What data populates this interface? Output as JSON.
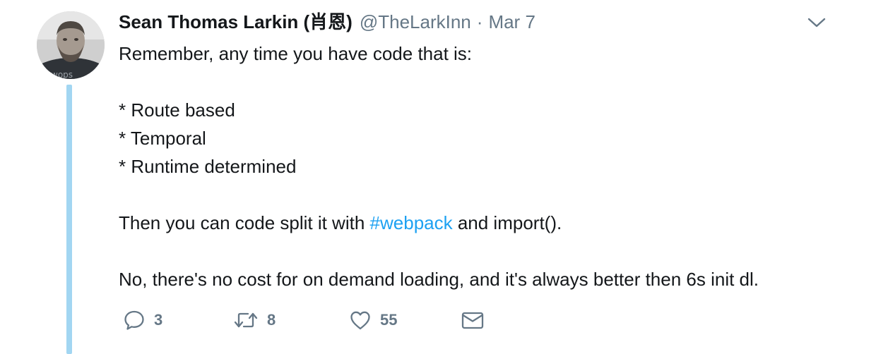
{
  "tweet": {
    "fullname": "Sean Thomas Larkin (肖恩)",
    "username": "@TheLarkInn",
    "separator": "·",
    "timestamp": "Mar 7",
    "lines": [
      {
        "text": "Remember, any time you have code that is:"
      },
      {
        "text": ""
      },
      {
        "text": "* Route based"
      },
      {
        "text": "* Temporal"
      },
      {
        "text": "* Runtime determined"
      },
      {
        "text": ""
      },
      {
        "before": "Then you can code split it with ",
        "hashtag": "#webpack",
        "after": " and import()."
      },
      {
        "text": ""
      },
      {
        "text": "No, there's no cost for on demand loading, and it's always better then 6s init dl."
      }
    ]
  },
  "actions": {
    "reply_count": "3",
    "retweet_count": "8",
    "like_count": "55"
  },
  "icons": {
    "reply": "reply-icon",
    "retweet": "retweet-icon",
    "like": "heart-icon",
    "message": "envelope-icon",
    "more": "chevron-down-icon"
  },
  "colors": {
    "text": "#14171a",
    "secondary": "#657786",
    "link": "#1da1f2",
    "thread_line": "#a2d6f2"
  }
}
